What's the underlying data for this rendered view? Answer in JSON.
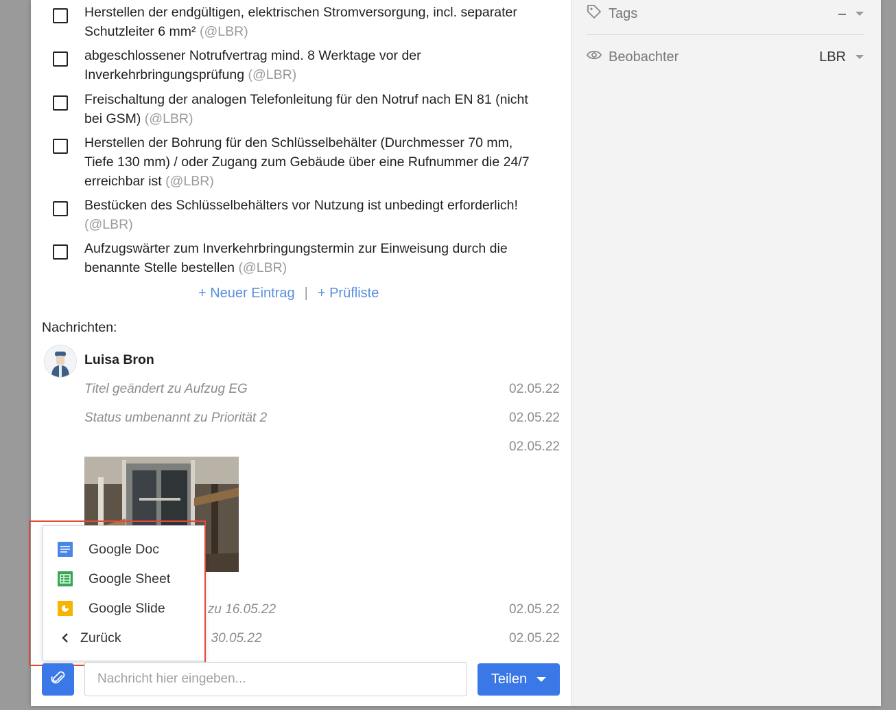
{
  "sidebar": {
    "tags": {
      "label": "Tags",
      "value": "–"
    },
    "watchers": {
      "label": "Beobachter",
      "value": "LBR"
    }
  },
  "checklist": [
    {
      "text": "Herstellen der endgültigen, elektrischen Stromversorgung, incl. separater Schutzleiter 6 mm²",
      "mention": "(@LBR)"
    },
    {
      "text": "abgeschlossener Notrufvertrag mind. 8 Werktage vor der Inverkehrbringungsprüfung",
      "mention": "(@LBR)"
    },
    {
      "text": "Freischaltung der analogen Telefonleitung für den Notruf nach EN 81 (nicht bei GSM)",
      "mention": "(@LBR)"
    },
    {
      "text": "Herstellen der Bohrung für den Schlüsselbehälter (Durchmesser 70 mm, Tiefe 130 mm) / oder Zugang zum Gebäude über eine Rufnummer die 24/7 erreichbar ist",
      "mention": "(@LBR)"
    },
    {
      "text": "Bestücken des Schlüsselbehälters vor Nutzung ist unbedingt erforderlich!",
      "mention": "(@LBR)"
    },
    {
      "text": "Aufzugswärter zum Inverkehrbringungstermin zur Einweisung durch die benannte Stelle bestellen",
      "mention": "(@LBR)"
    }
  ],
  "actions": {
    "new_entry": "+ Neuer Eintrag",
    "separator": "|",
    "checklist": "+ Prüfliste"
  },
  "messages": {
    "title": "Nachrichten:",
    "author": "Luisa Bron",
    "entries": [
      {
        "text": "Titel geändert zu Aufzug EG",
        "date": "02.05.22"
      },
      {
        "text": "Status umbenannt zu Priorität 2",
        "date": "02.05.22"
      },
      {
        "text": "",
        "date": "02.05.22"
      },
      {
        "text": "rt zu 16.05.22",
        "date": "02.05.22"
      },
      {
        "text": ". 30.05.22",
        "date": "02.05.22"
      }
    ]
  },
  "attach_menu": {
    "items": [
      {
        "label": "Google Doc",
        "icon": "google-doc-icon",
        "color": "#4a86e8"
      },
      {
        "label": "Google Sheet",
        "icon": "google-sheet-icon",
        "color": "#34a853"
      },
      {
        "label": "Google Slide",
        "icon": "google-slide-icon",
        "color": "#f4b400"
      },
      {
        "label": "Zurück",
        "icon": "chevron-left-icon"
      }
    ]
  },
  "composer": {
    "placeholder": "Nachricht hier eingeben...",
    "share_label": "Teilen"
  },
  "colors": {
    "accent": "#3b78e7",
    "link": "#5a8fe0",
    "highlight": "#e04a3a"
  }
}
